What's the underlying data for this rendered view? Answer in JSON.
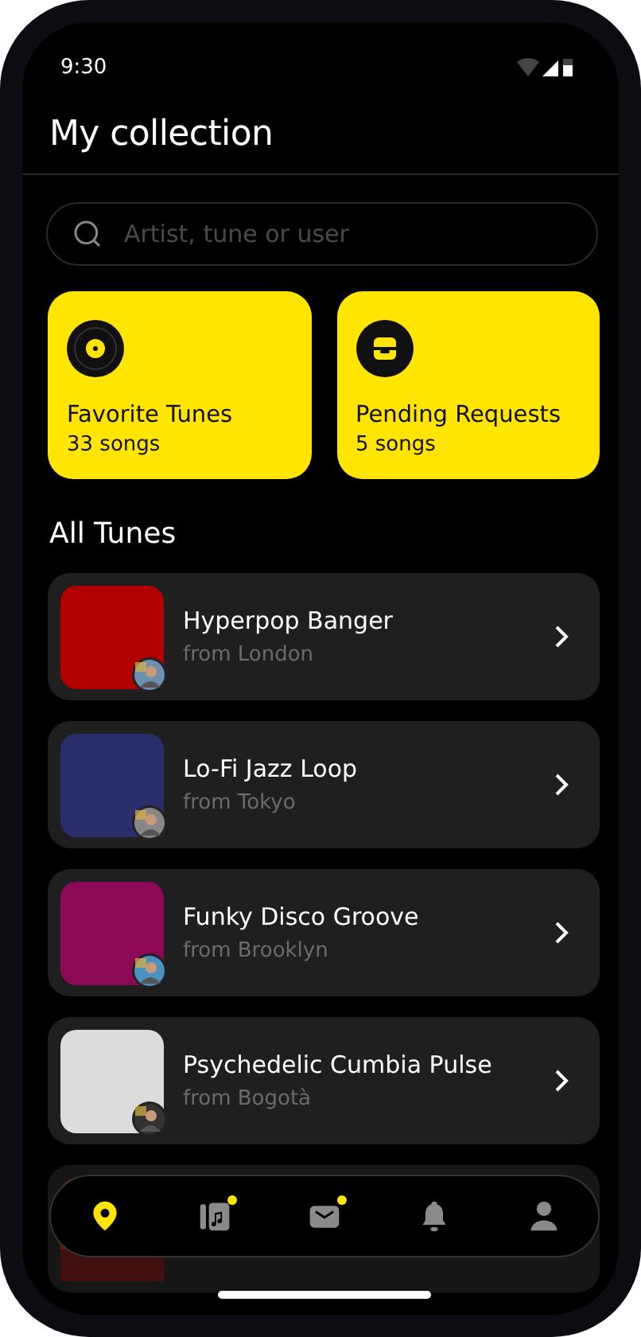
{
  "status_bar": {
    "time": "9:30"
  },
  "title": "My collection",
  "search": {
    "placeholder": "Artist, tune or user"
  },
  "collections": [
    {
      "kind": "vinyl",
      "title": "Favorite Tunes",
      "count": "33 songs"
    },
    {
      "kind": "inbox",
      "title": "Pending Requests",
      "count": "5 songs"
    }
  ],
  "section_title": "All Tunes",
  "tunes": [
    {
      "title": "Hyperpop Banger",
      "origin": "from London",
      "color": "#b00000"
    },
    {
      "title": "Lo-Fi Jazz Loop",
      "origin": "from Tokyo",
      "color": "#2a2f6c"
    },
    {
      "title": "Funky Disco Groove",
      "origin": "from Brooklyn",
      "color": "#8c0a55"
    },
    {
      "title": "Psychedelic Cumbia Pulse",
      "origin": "from Bogotà",
      "color": "#dcdcdc"
    }
  ],
  "nav": [
    {
      "kind": "pin",
      "selected": true,
      "badge": false
    },
    {
      "kind": "music",
      "selected": false,
      "badge": true
    },
    {
      "kind": "mail",
      "selected": false,
      "badge": true
    },
    {
      "kind": "bell",
      "selected": false,
      "badge": false
    },
    {
      "kind": "person",
      "selected": false,
      "badge": false
    }
  ]
}
